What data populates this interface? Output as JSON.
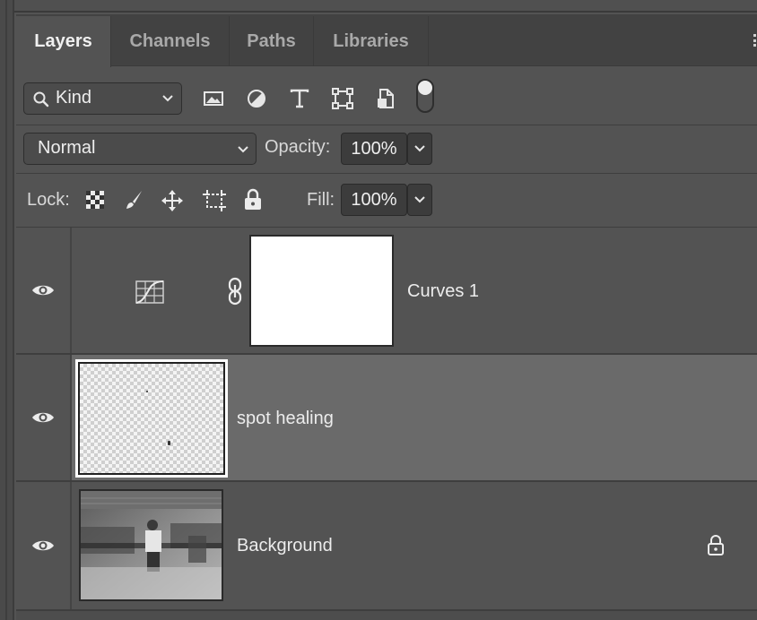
{
  "tabs": [
    {
      "label": "Layers",
      "active": true
    },
    {
      "label": "Channels",
      "active": false
    },
    {
      "label": "Paths",
      "active": false
    },
    {
      "label": "Libraries",
      "active": false
    }
  ],
  "filter": {
    "kind_label": "Kind",
    "icons": [
      "image-filter-icon",
      "adjustment-filter-icon",
      "type-filter-icon",
      "shape-filter-icon",
      "smart-object-filter-icon",
      "filter-toggle-icon"
    ]
  },
  "blend": {
    "mode": "Normal",
    "opacity_label": "Opacity:",
    "opacity_value": "100%"
  },
  "lock": {
    "label": "Lock:",
    "icons": [
      "lock-transparent-pixels-icon",
      "lock-image-pixels-icon",
      "lock-position-icon",
      "lock-artboard-icon",
      "lock-all-icon"
    ],
    "fill_label": "Fill:",
    "fill_value": "100%"
  },
  "layers": [
    {
      "name": "Curves 1",
      "type": "adjustment",
      "visible": true,
      "selected": false
    },
    {
      "name": "spot healing",
      "type": "pixel",
      "visible": true,
      "selected": true
    },
    {
      "name": "Background",
      "type": "background",
      "visible": true,
      "selected": false,
      "locked": true
    }
  ],
  "colors": {
    "panel_bg": "#535353",
    "tabbar_bg": "#424242",
    "selected_row": "#6a6a6a"
  }
}
